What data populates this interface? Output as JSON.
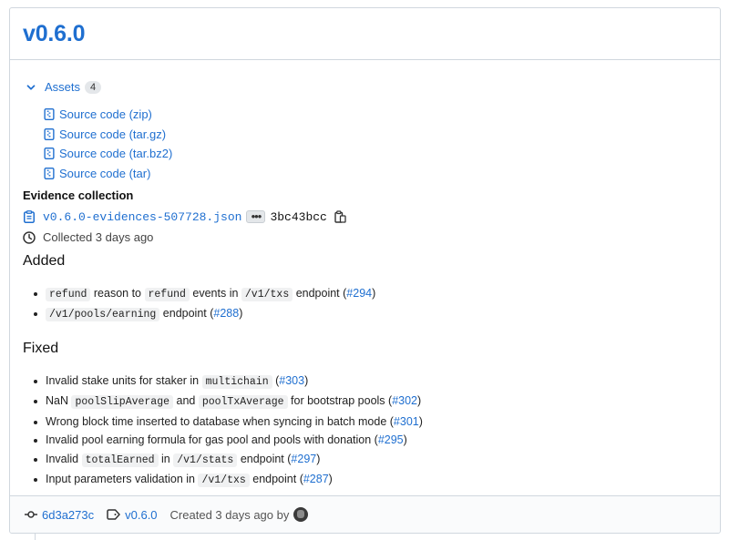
{
  "release": {
    "title": "v0.6.0"
  },
  "assets": {
    "label": "Assets",
    "count": "4",
    "items": [
      {
        "label": "Source code (zip)"
      },
      {
        "label": "Source code (tar.gz)"
      },
      {
        "label": "Source code (tar.bz2)"
      },
      {
        "label": "Source code (tar)"
      }
    ]
  },
  "evidence": {
    "heading": "Evidence collection",
    "file": "v0.6.0-evidences-507728.json",
    "sha": "3bc43bcc",
    "collected": "Collected 3 days ago"
  },
  "added": {
    "title": "Added",
    "items": [
      {
        "parts": [
          {
            "code": "refund"
          },
          {
            "text": " reason to "
          },
          {
            "code": "refund"
          },
          {
            "text": " events in "
          },
          {
            "code": "/v1/txs"
          },
          {
            "text": " endpoint ("
          },
          {
            "link": "#294"
          },
          {
            "text": ")"
          }
        ]
      },
      {
        "parts": [
          {
            "code": "/v1/pools/earning"
          },
          {
            "text": " endpoint ("
          },
          {
            "link": "#288"
          },
          {
            "text": ")"
          }
        ]
      }
    ]
  },
  "fixed": {
    "title": "Fixed",
    "items": [
      {
        "parts": [
          {
            "text": "Invalid stake units for staker in "
          },
          {
            "code": "multichain"
          },
          {
            "text": " ("
          },
          {
            "link": "#303"
          },
          {
            "text": ")"
          }
        ]
      },
      {
        "parts": [
          {
            "text": "NaN "
          },
          {
            "code": "poolSlipAverage"
          },
          {
            "text": " and "
          },
          {
            "code": "poolTxAverage"
          },
          {
            "text": " for bootstrap pools ("
          },
          {
            "link": "#302"
          },
          {
            "text": ")"
          }
        ]
      },
      {
        "parts": [
          {
            "text": "Wrong block time inserted to database when syncing in batch mode ("
          },
          {
            "link": "#301"
          },
          {
            "text": ")"
          }
        ]
      },
      {
        "parts": [
          {
            "text": "Invalid pool earning formula for gas pool and pools with donation ("
          },
          {
            "link": "#295"
          },
          {
            "text": ")"
          }
        ]
      },
      {
        "parts": [
          {
            "text": "Invalid "
          },
          {
            "code": "totalEarned"
          },
          {
            "text": " in "
          },
          {
            "code": "/v1/stats"
          },
          {
            "text": " endpoint ("
          },
          {
            "link": "#297"
          },
          {
            "text": ")"
          }
        ]
      },
      {
        "parts": [
          {
            "text": "Input parameters validation in "
          },
          {
            "code": "/v1/txs"
          },
          {
            "text": " endpoint ("
          },
          {
            "link": "#287"
          },
          {
            "text": ")"
          }
        ]
      }
    ]
  },
  "footer": {
    "commit": "6d3a273c",
    "tag": "v0.6.0",
    "created": "Created 3 days ago by"
  },
  "colors": {
    "link": "#1f6fd0",
    "border": "#d0d7de"
  }
}
